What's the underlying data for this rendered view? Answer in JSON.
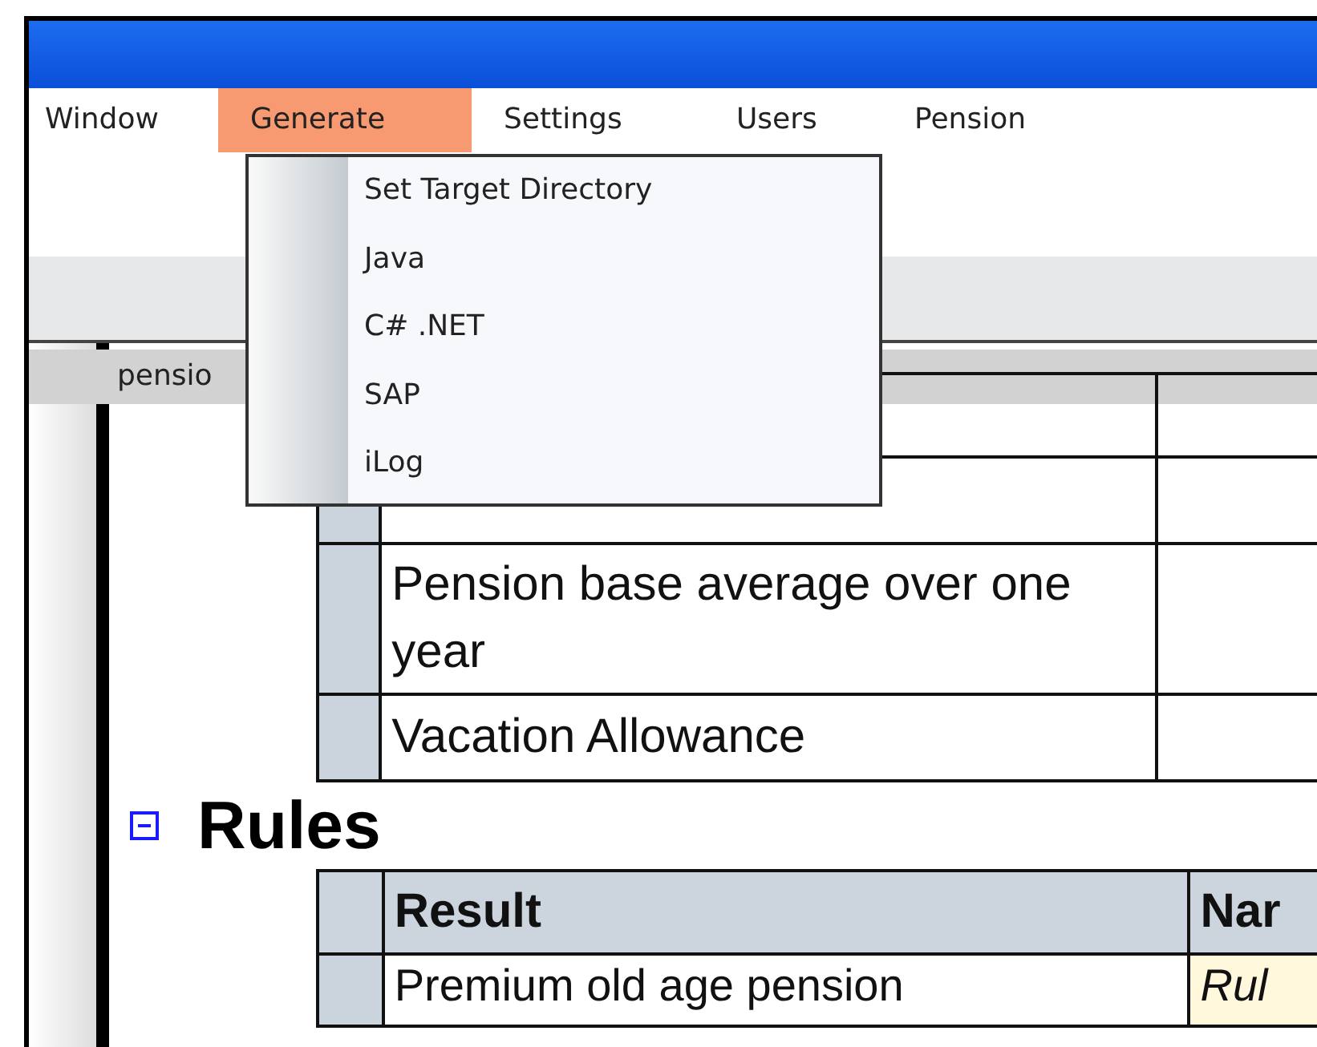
{
  "menu_bar": [
    {
      "label": "Window",
      "selected": false
    },
    {
      "label": "Generate",
      "selected": true
    },
    {
      "label": "Settings",
      "selected": false
    },
    {
      "label": "Users",
      "selected": false
    },
    {
      "label": "Pension",
      "selected": false
    }
  ],
  "dropdown": [
    "Set Target Directory",
    "Java",
    "C# .NET",
    "SAP",
    "iLog"
  ],
  "tab": {
    "label": "pensio"
  },
  "first_table": {
    "rows": [
      {
        "cells": [
          "",
          ""
        ]
      },
      {
        "cells": [
          "",
          ""
        ]
      },
      {
        "cells": [
          "Pension base average over one year",
          ""
        ]
      },
      {
        "cells": [
          "Vacation Allowance",
          ""
        ]
      }
    ]
  },
  "section": {
    "title": "Rules",
    "expanded": true
  },
  "rules_table": {
    "columns": [
      "Result",
      "Nar"
    ],
    "rows": [
      {
        "cells": [
          "Premium old age pension",
          "Rul"
        ]
      }
    ]
  }
}
